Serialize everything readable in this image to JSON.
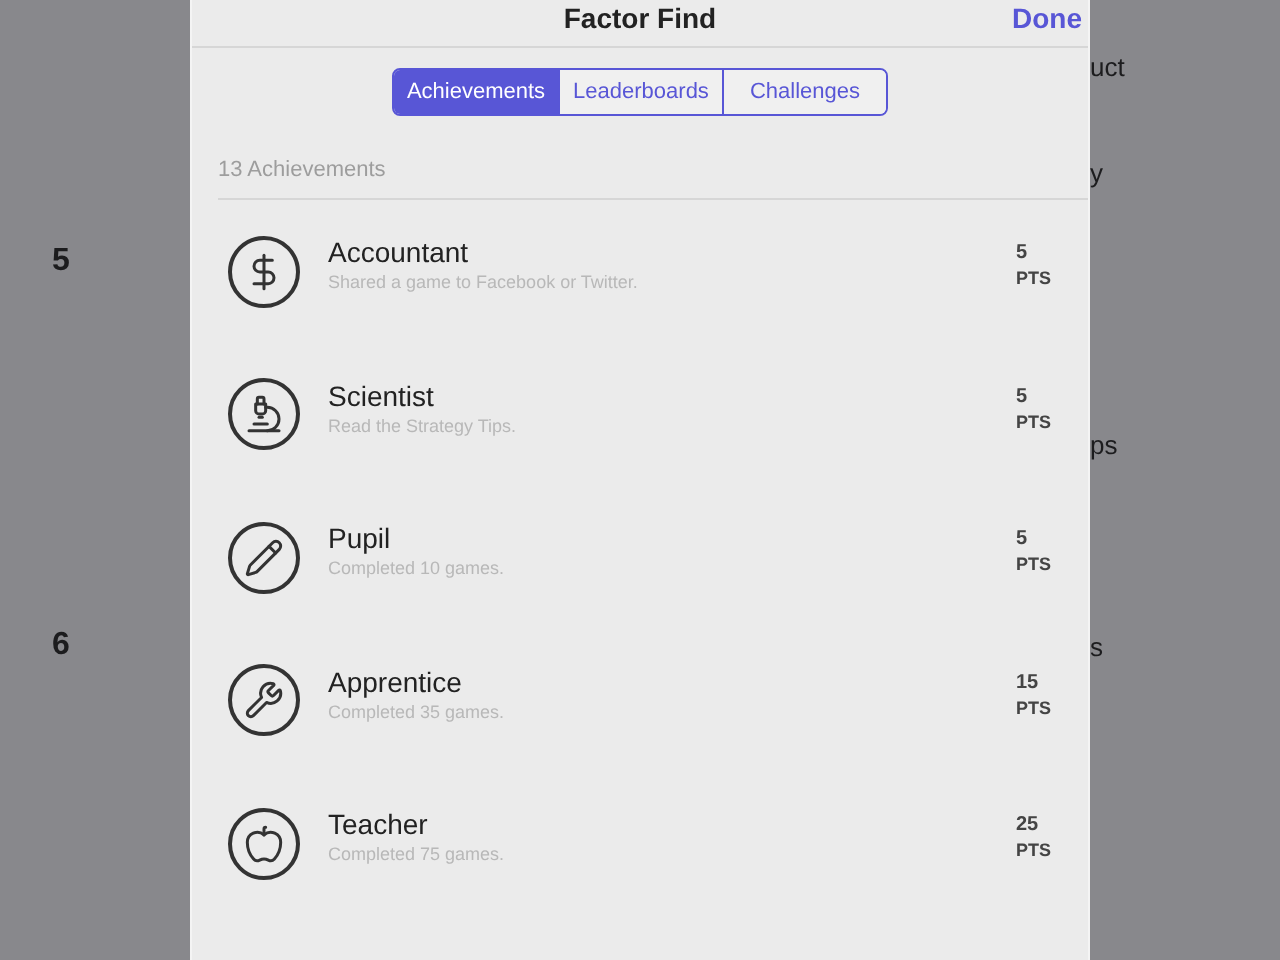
{
  "background_left": {
    "numbers": [
      "5",
      "6"
    ]
  },
  "background_right": {
    "rows": [
      {
        "text": "uct"
      },
      {
        "text": "y"
      },
      {
        "text": "ps"
      },
      {
        "text": "s"
      }
    ]
  },
  "window": {
    "title": "Factor Find",
    "done": "Done"
  },
  "tabs": [
    {
      "label": "Achievements",
      "selected": true
    },
    {
      "label": "Leaderboards",
      "selected": false
    },
    {
      "label": "Challenges",
      "selected": false
    }
  ],
  "list_header": "13 Achievements",
  "achievements": [
    {
      "title": "Accountant",
      "description": "Shared a game to Facebook or Twitter.",
      "points": "5",
      "unit": "PTS"
    },
    {
      "title": "Scientist",
      "description": "Read the Strategy Tips.",
      "points": "5",
      "unit": "PTS"
    },
    {
      "title": "Pupil",
      "description": "Completed 10 games.",
      "points": "5",
      "unit": "PTS"
    },
    {
      "title": "Apprentice",
      "description": "Completed 35 games.",
      "points": "15",
      "unit": "PTS"
    },
    {
      "title": "Teacher",
      "description": "Completed 75 games.",
      "points": "25",
      "unit": "PTS"
    }
  ]
}
